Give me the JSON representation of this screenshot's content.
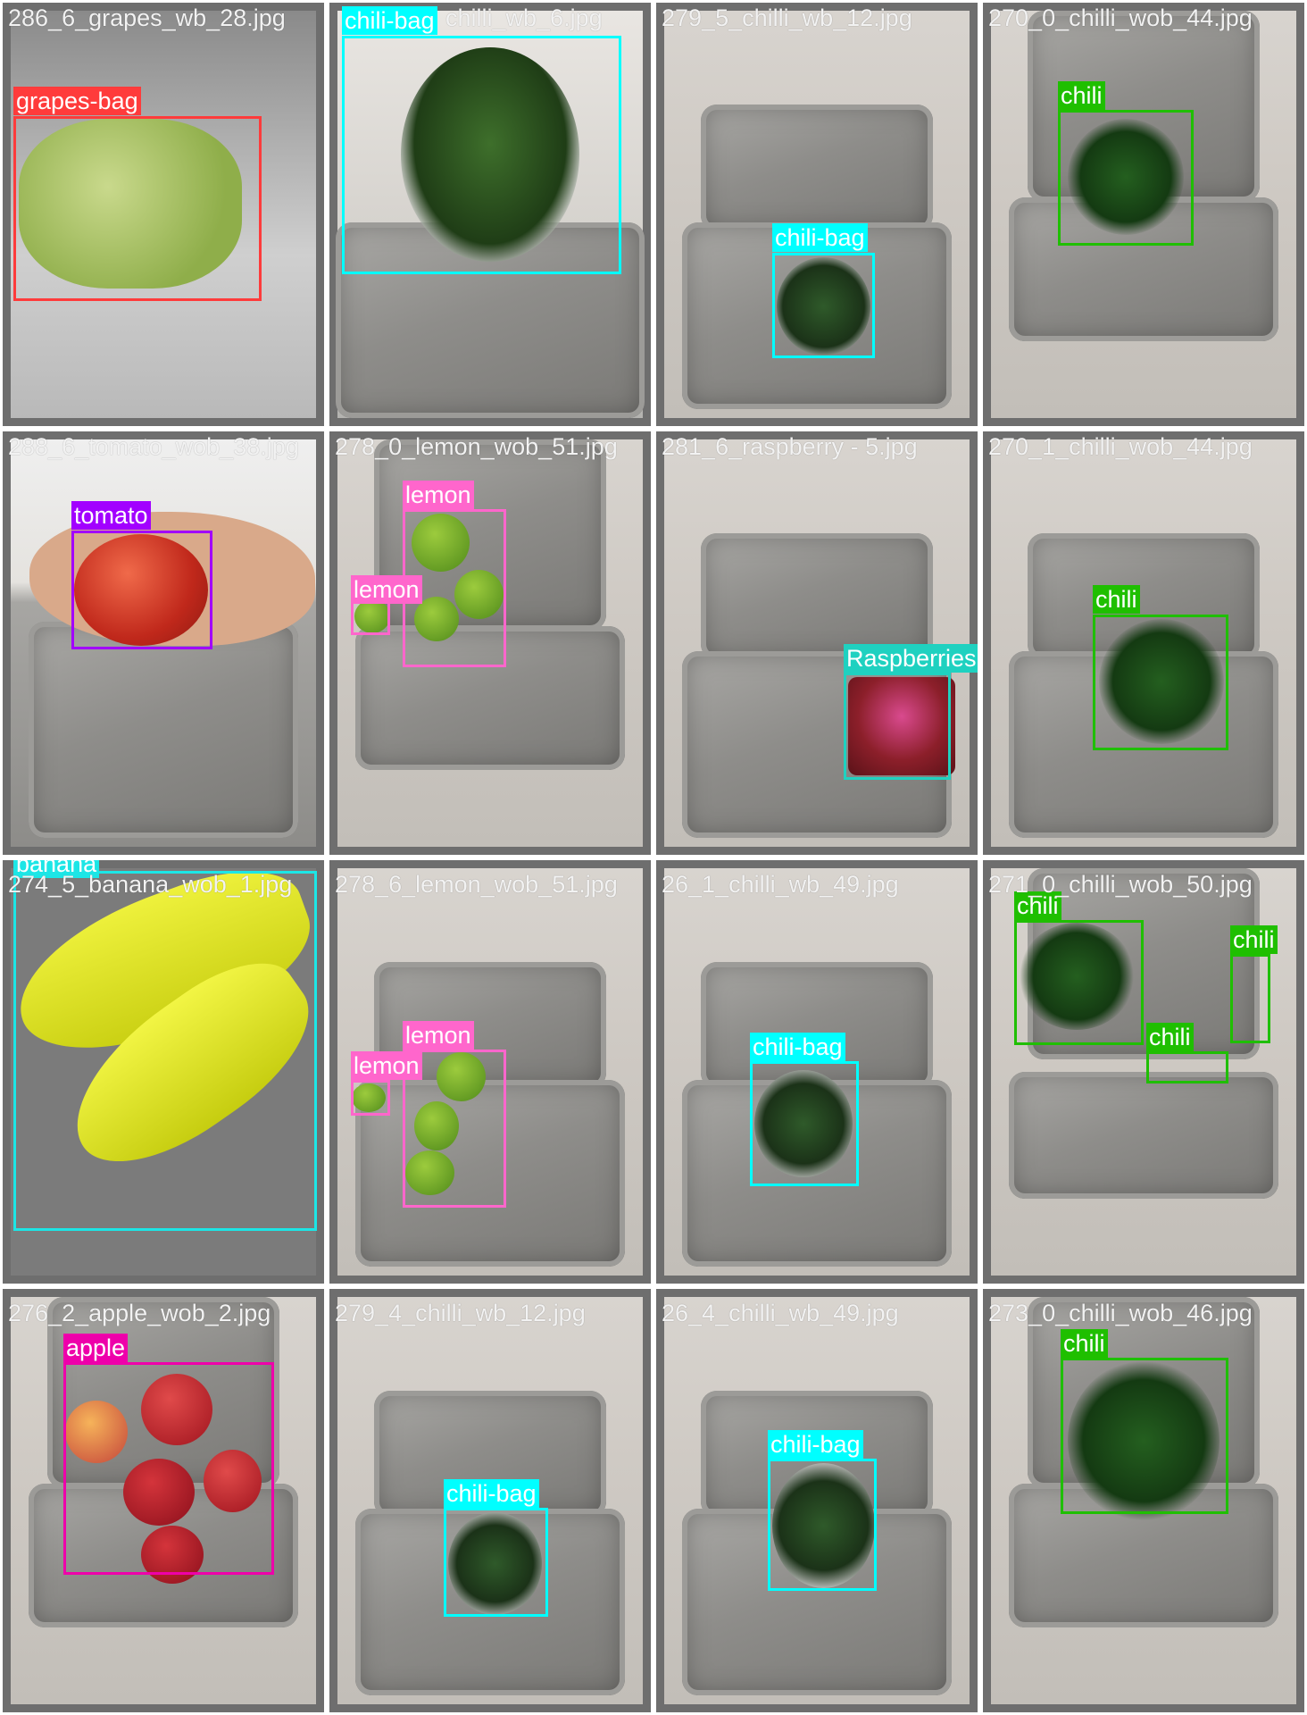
{
  "colors": {
    "grapes-bag": "#ff3b3b",
    "chili-bag": "#00ffff",
    "chili": "#1fbf00",
    "tomato": "#a200ff",
    "lemon": "#ff66cc",
    "Raspberries": "#1fd1c0",
    "banana": "#1ce6e6",
    "apple": "#ee00aa"
  },
  "tiles": [
    {
      "filename": "286_6_grapes_wb_28.jpg",
      "scene": "grapes",
      "labels": [
        "grapes-bag"
      ]
    },
    {
      "filename": "chilli_wb_6.jpg",
      "scene": "chilibag-hand",
      "labels": [
        "chili-bag"
      ]
    },
    {
      "filename": "279_5_chilli_wb_12.jpg",
      "scene": "tray",
      "labels": [
        "chili-bag"
      ]
    },
    {
      "filename": "270_0_chilli_wob_44.jpg",
      "scene": "tray",
      "labels": [
        "chili"
      ]
    },
    {
      "filename": "288_6_tomato_wob_38.jpg",
      "scene": "tray",
      "labels": [
        "tomato"
      ]
    },
    {
      "filename": "278_0_lemon_wob_51.jpg",
      "scene": "tray",
      "labels": [
        "lemon",
        "lemon"
      ]
    },
    {
      "filename": "281_6_raspberry - 5.jpg",
      "scene": "tray",
      "labels": [
        "Raspberries"
      ]
    },
    {
      "filename": "270_1_chilli_wob_44.jpg",
      "scene": "tray",
      "labels": [
        "chili"
      ]
    },
    {
      "filename": "274_5_banana_wob_1.jpg",
      "scene": "banana",
      "labels": [
        "banana"
      ]
    },
    {
      "filename": "278_6_lemon_wob_51.jpg",
      "scene": "tray",
      "labels": [
        "lemon",
        "lemon"
      ]
    },
    {
      "filename": "26_1_chilli_wb_49.jpg",
      "scene": "tray",
      "labels": [
        "chili-bag"
      ]
    },
    {
      "filename": "271_0_chilli_wob_50.jpg",
      "scene": "tray",
      "labels": [
        "chili",
        "chili",
        "chili"
      ]
    },
    {
      "filename": "276_2_apple_wob_2.jpg",
      "scene": "tray",
      "labels": [
        "apple"
      ]
    },
    {
      "filename": "279_4_chilli_wb_12.jpg",
      "scene": "tray",
      "labels": [
        "chili-bag"
      ]
    },
    {
      "filename": "26_4_chilli_wb_49.jpg",
      "scene": "tray",
      "labels": [
        "chili-bag"
      ]
    },
    {
      "filename": "273_0_chilli_wob_46.jpg",
      "scene": "tray",
      "labels": [
        "chili"
      ]
    }
  ]
}
